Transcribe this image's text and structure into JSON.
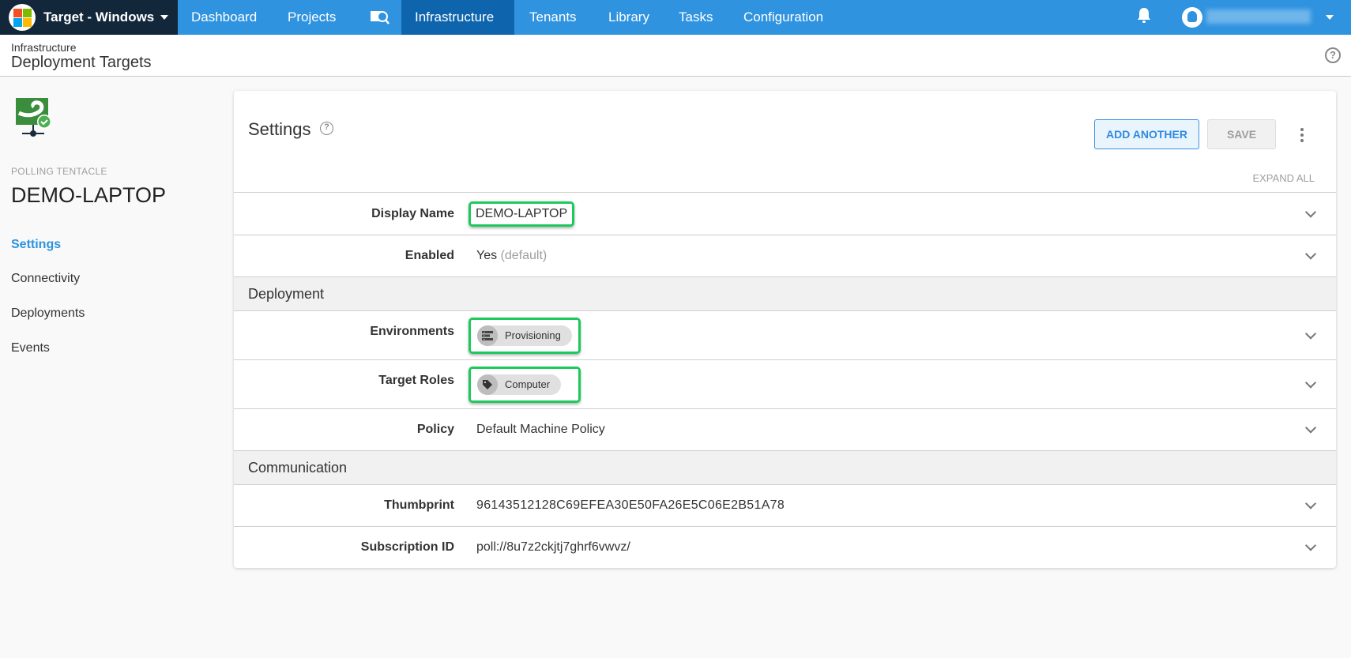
{
  "nav": {
    "space_name": "Target - Windows",
    "items": [
      "Dashboard",
      "Projects",
      "Infrastructure",
      "Tenants",
      "Library",
      "Tasks",
      "Configuration"
    ],
    "active": "Infrastructure"
  },
  "header": {
    "breadcrumb": "Infrastructure",
    "title": "Deployment Targets"
  },
  "sidebar": {
    "type_label": "POLLING TENTACLE",
    "machine_name": "DEMO-LAPTOP",
    "links": [
      "Settings",
      "Connectivity",
      "Deployments",
      "Events"
    ]
  },
  "card": {
    "title": "Settings",
    "add_another": "ADD ANOTHER",
    "save": "SAVE",
    "expand_all": "EXPAND ALL",
    "display_name_label": "Display Name",
    "display_name": "DEMO-LAPTOP",
    "enabled_label": "Enabled",
    "enabled_value": "Yes",
    "enabled_hint": "(default)",
    "section_deployment": "Deployment",
    "environments_label": "Environments",
    "environment": "Provisioning",
    "roles_label": "Target Roles",
    "role": "Computer",
    "policy_label": "Policy",
    "policy": "Default Machine Policy",
    "section_communication": "Communication",
    "thumbprint_label": "Thumbprint",
    "thumbprint": "96143512128C69EFEA30E50FA26E5C06E2B51A78",
    "subscription_label": "Subscription ID",
    "subscription": "poll://8u7z2ckjtj7ghrf6vwvz/"
  },
  "colors": {
    "nav": "#2f93e0",
    "nav_active": "#0e65ad",
    "brand_bg": "#13273b",
    "highlight": "#1ec95c",
    "link_active": "#2f93e0"
  }
}
